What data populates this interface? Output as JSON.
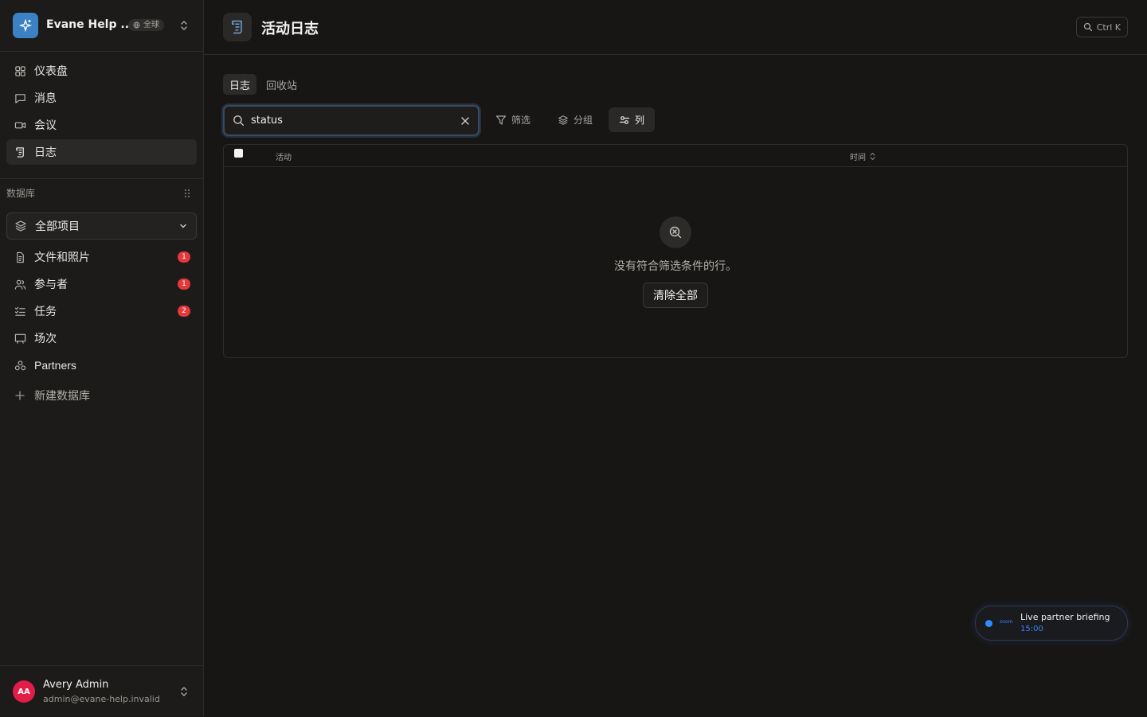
{
  "workspace": {
    "name": "Evane Help ...",
    "scope_badge": "全球"
  },
  "nav": {
    "items": [
      {
        "label": "仪表盘"
      },
      {
        "label": "消息"
      },
      {
        "label": "会议"
      },
      {
        "label": "日志"
      }
    ]
  },
  "database": {
    "section_label": "数据库",
    "selector_label": "全部项目",
    "items": [
      {
        "label": "文件和照片",
        "count": "1"
      },
      {
        "label": "参与者",
        "count": "1"
      },
      {
        "label": "任务",
        "count": "2"
      },
      {
        "label": "场次"
      },
      {
        "label": "Partners"
      }
    ],
    "new_label": "新建数据库"
  },
  "user": {
    "initials": "AA",
    "name": "Avery Admin",
    "email": "admin@evane-help.invalid"
  },
  "header": {
    "title": "活动日志",
    "shortcut": "Ctrl K"
  },
  "tabs": [
    {
      "label": "日志",
      "active": true
    },
    {
      "label": "回收站",
      "active": false
    }
  ],
  "toolbar": {
    "search_value": "status",
    "filter_label": "筛选",
    "group_label": "分组",
    "columns_label": "列"
  },
  "table": {
    "columns": [
      "活动",
      "时间"
    ],
    "empty_message": "没有符合筛选条件的行。",
    "clear_all_label": "清除全部"
  },
  "toast": {
    "brand": "zoom",
    "title": "Live partner briefing",
    "time": "15:00"
  },
  "colors": {
    "accent": "#3b82c4",
    "badge": "#e5383b",
    "zoom": "#2d8cff"
  }
}
